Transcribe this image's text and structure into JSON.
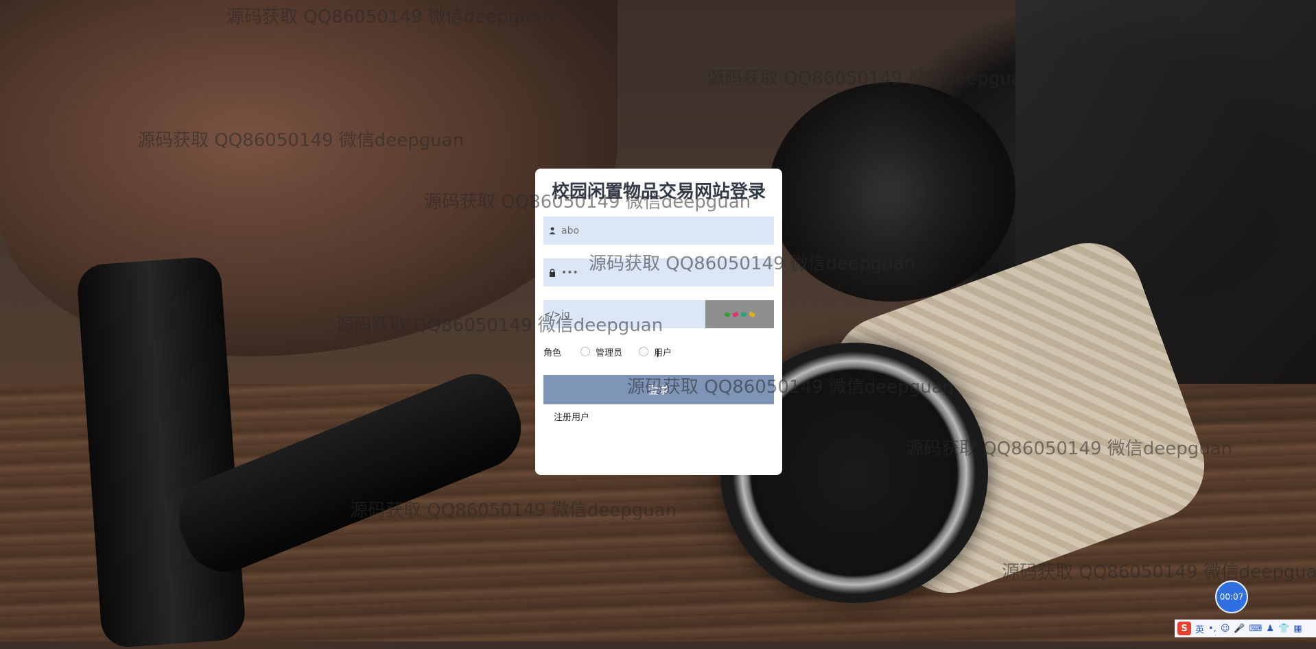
{
  "page": {
    "title": "校园闲置物品交易网站登录"
  },
  "form": {
    "username_placeholder": "abo",
    "password_value": "•••",
    "captcha_placeholder": "jg",
    "captcha_chars": [
      "",
      "",
      "",
      ""
    ],
    "captcha_colors": [
      "#3a9a3a",
      "#d63a6a",
      "#2fa07a",
      "#e0b020"
    ],
    "role_label": "角色",
    "role_options": [
      "管理员",
      "用户"
    ],
    "login_button": "登录",
    "register_link": "注册用户"
  },
  "watermark_text": "源码获取 QQ86050149 微信deepguan",
  "timer": "00:07",
  "ime": {
    "mode": "英"
  },
  "colors": {
    "input_bg": "#dbe6f7",
    "button_bg": "#7f95b8",
    "captcha_bg": "#8f8f8f",
    "timer_bg": "#2f6fe0"
  }
}
